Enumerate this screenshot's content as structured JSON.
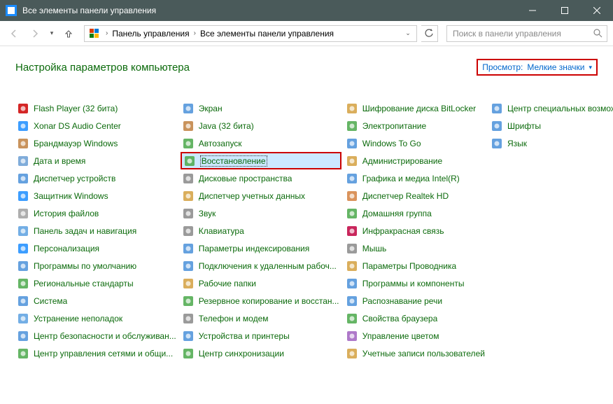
{
  "window": {
    "title": "Все элементы панели управления"
  },
  "toolbar": {
    "breadcrumb": [
      "Панель управления",
      "Все элементы панели управления"
    ],
    "search_placeholder": "Поиск в панели управления"
  },
  "content": {
    "heading": "Настройка параметров компьютера",
    "view_label": "Просмотр:",
    "view_value": "Мелкие значки"
  },
  "items": [
    {
      "label": "Flash Player (32 бита)",
      "icon": "flash",
      "color": "#c00"
    },
    {
      "label": "Xonar DS Audio Center",
      "icon": "audio",
      "color": "#1a8cff"
    },
    {
      "label": "Брандмауэр Windows",
      "icon": "wall",
      "color": "#c08040"
    },
    {
      "label": "Дата и время",
      "icon": "clock",
      "color": "#6a9ed4"
    },
    {
      "label": "Диспетчер устройств",
      "icon": "devices",
      "color": "#4a90d9"
    },
    {
      "label": "Защитник Windows",
      "icon": "shield",
      "color": "#1a8cff"
    },
    {
      "label": "История файлов",
      "icon": "history",
      "color": "#a0a0a0"
    },
    {
      "label": "Панель задач и навигация",
      "icon": "taskbar",
      "color": "#5ba0e0"
    },
    {
      "label": "Персонализация",
      "icon": "personalize",
      "color": "#1a8cff"
    },
    {
      "label": "Программы по умолчанию",
      "icon": "defaults",
      "color": "#4a90d9"
    },
    {
      "label": "Региональные стандарты",
      "icon": "region",
      "color": "#4aa84a"
    },
    {
      "label": "Система",
      "icon": "system",
      "color": "#4a90d9"
    },
    {
      "label": "Устранение неполадок",
      "icon": "troubleshoot",
      "color": "#5ba0e0"
    },
    {
      "label": "Центр безопасности и обслуживан...",
      "icon": "flag",
      "color": "#4a90d9"
    },
    {
      "label": "Центр управления сетями и общи...",
      "icon": "network",
      "color": "#4aa84a"
    },
    {
      "label": "Экран",
      "icon": "screen",
      "color": "#4a90d9"
    },
    {
      "label": "Java (32 бита)",
      "icon": "java",
      "color": "#c08040"
    },
    {
      "label": "Автозапуск",
      "icon": "autoplay",
      "color": "#4aa84a"
    },
    {
      "label": "Восстановление",
      "icon": "recovery",
      "color": "#4aa84a",
      "highlighted": true
    },
    {
      "label": "Дисковые пространства",
      "icon": "storage",
      "color": "#888"
    },
    {
      "label": "Диспетчер учетных данных",
      "icon": "credentials",
      "color": "#d4a040"
    },
    {
      "label": "Звук",
      "icon": "sound",
      "color": "#888"
    },
    {
      "label": "Клавиатура",
      "icon": "keyboard",
      "color": "#888"
    },
    {
      "label": "Параметры индексирования",
      "icon": "index",
      "color": "#4a90d9"
    },
    {
      "label": "Подключения к удаленным рабоч...",
      "icon": "remote",
      "color": "#4a90d9"
    },
    {
      "label": "Рабочие папки",
      "icon": "workfolders",
      "color": "#d4a040"
    },
    {
      "label": "Резервное копирование и восстан...",
      "icon": "backup",
      "color": "#4aa84a"
    },
    {
      "label": "Телефон и модем",
      "icon": "phone",
      "color": "#888"
    },
    {
      "label": "Устройства и принтеры",
      "icon": "printers",
      "color": "#4a90d9"
    },
    {
      "label": "Центр синхронизации",
      "icon": "sync",
      "color": "#4aa84a"
    },
    {
      "label": "Шифрование диска BitLocker",
      "icon": "bitlocker",
      "color": "#d4a040"
    },
    {
      "label": "Электропитание",
      "icon": "power",
      "color": "#4aa84a"
    },
    {
      "label": "Windows To Go",
      "icon": "wtg",
      "color": "#4a90d9"
    },
    {
      "label": "Администрирование",
      "icon": "admin",
      "color": "#d4a040"
    },
    {
      "label": "Графика и медиа Intel(R)",
      "icon": "intel",
      "color": "#4a90d9"
    },
    {
      "label": "Диспетчер Realtek HD",
      "icon": "realtek",
      "color": "#d48040"
    },
    {
      "label": "Домашняя группа",
      "icon": "homegroup",
      "color": "#4aa84a"
    },
    {
      "label": "Инфракрасная связь",
      "icon": "infrared",
      "color": "#c00040"
    },
    {
      "label": "Мышь",
      "icon": "mouse",
      "color": "#888"
    },
    {
      "label": "Параметры Проводника",
      "icon": "explorer",
      "color": "#d4a040"
    },
    {
      "label": "Программы и компоненты",
      "icon": "programs",
      "color": "#4a90d9"
    },
    {
      "label": "Распознавание речи",
      "icon": "speech",
      "color": "#4a90d9"
    },
    {
      "label": "Свойства браузера",
      "icon": "internet",
      "color": "#4aa84a"
    },
    {
      "label": "Управление цветом",
      "icon": "color",
      "color": "#a060c0"
    },
    {
      "label": "Учетные записи пользователей",
      "icon": "users",
      "color": "#d4a040"
    },
    {
      "label": "Центр специальных возможностей",
      "icon": "ease",
      "color": "#4a90d9"
    },
    {
      "label": "Шрифты",
      "icon": "fonts",
      "color": "#4a90d9"
    },
    {
      "label": "Язык",
      "icon": "language",
      "color": "#4a90d9"
    }
  ]
}
